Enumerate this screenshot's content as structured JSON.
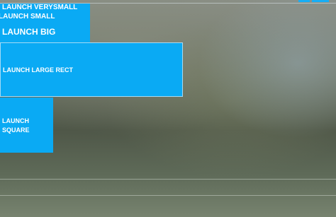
{
  "buttons": {
    "verysmall": "LAUNCH VERYSMALL",
    "small": "LAUNCH SMALL",
    "big": "LAUNCH BIG",
    "large_rect": "LAUNCH LARGE RECT",
    "square_line1": "LAUNCH",
    "square_line2": "SQUARE"
  },
  "colors": {
    "accent": "#0aaaf4"
  }
}
